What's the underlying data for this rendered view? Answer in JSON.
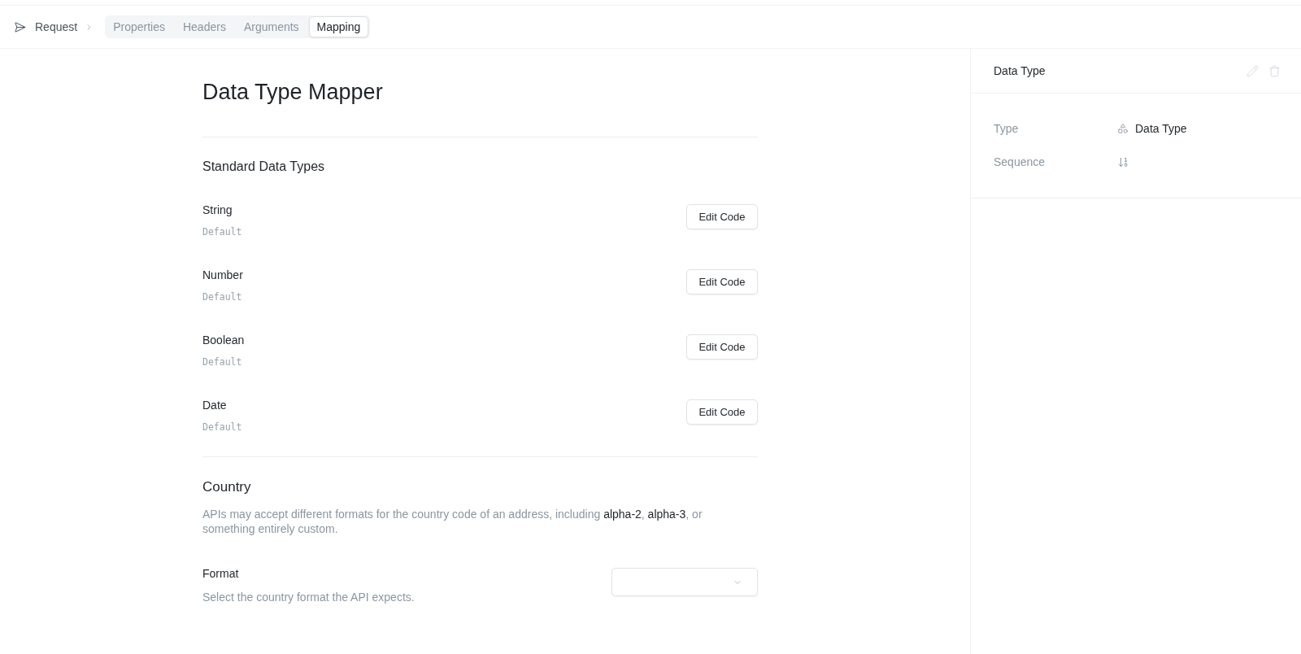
{
  "topbar": {
    "breadcrumb": "Request",
    "tabs": [
      {
        "label": "Properties",
        "selected": false
      },
      {
        "label": "Headers",
        "selected": false
      },
      {
        "label": "Arguments",
        "selected": false
      },
      {
        "label": "Mapping",
        "selected": true
      }
    ]
  },
  "main": {
    "title": "Data Type Mapper",
    "sections": [
      {
        "kind": "type_list",
        "heading": "Standard Data Types",
        "items": [
          {
            "name": "String",
            "value": "Default",
            "button": "Edit Code"
          },
          {
            "name": "Number",
            "value": "Default",
            "button": "Edit Code"
          },
          {
            "name": "Boolean",
            "value": "Default",
            "button": "Edit Code"
          },
          {
            "name": "Date",
            "value": "Default",
            "button": "Edit Code"
          }
        ]
      },
      {
        "kind": "select_setting",
        "heading": "Country",
        "description": "APIs may accept different formats for the country code of an address, including **alpha-2**, **alpha-3**, or something entirely custom.",
        "fields": [
          {
            "label": "Format",
            "hint": "Select the country format the API expects."
          }
        ]
      }
    ]
  },
  "details": {
    "title": "Data Type",
    "actions": [
      {
        "kind": "edit",
        "disabled": true
      },
      {
        "kind": "delete",
        "disabled": true
      }
    ],
    "properties": [
      {
        "label": "Type",
        "kind": "type",
        "value": "Data Type"
      },
      {
        "label": "Sequence",
        "kind": "sequence"
      }
    ]
  }
}
